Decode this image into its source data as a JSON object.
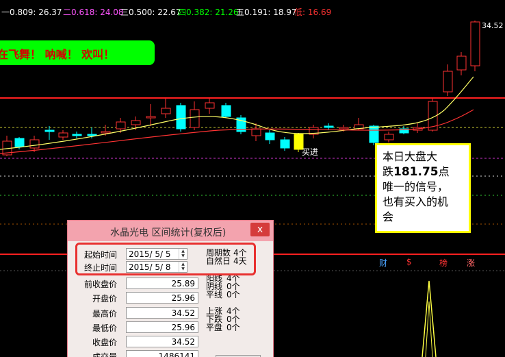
{
  "fib_levels": [
    {
      "label": "一0.809: 26.37",
      "color": "#ffffff"
    },
    {
      "label": "二0.618: 24.08",
      "color": "#ff55ff"
    },
    {
      "label": "三0.500: 22.67",
      "color": "#ffffff"
    },
    {
      "label": "四0.382: 21.26",
      "color": "#00ff00"
    },
    {
      "label": "五0.191: 18.97",
      "color": "#ffffff"
    },
    {
      "label": "低: 16.69",
      "color": "#ff3333"
    }
  ],
  "banner_text": "在飞舞！ 呐喊！ 欢叫！",
  "note": {
    "line1": "本日大盘大",
    "line2_pre": "跌",
    "line2_num": "181.75",
    "line2_post": "点",
    "line3": "唯一的信号，",
    "line4": "也有买入的机",
    "line5": "会"
  },
  "buy_label": "买进",
  "high_price_label": "34.52",
  "flags": [
    {
      "text": "财",
      "color": "#4aa3ff"
    },
    {
      "text": "$",
      "color": "#ff3333"
    },
    {
      "text": "榜",
      "color": "#ff3333"
    },
    {
      "text": "涨",
      "color": "#ff6666"
    }
  ],
  "dialog": {
    "title": "水晶光电 区间统计(复权后)",
    "close": "x",
    "start_label": "起始时间",
    "start_value": "2015/ 5/ 5",
    "end_label": "终止时间",
    "end_value": "2015/ 5/ 8",
    "period_label": "周期数",
    "period_value": "4个",
    "natural_label": "自然日",
    "natural_value": "4天",
    "fields": [
      {
        "label": "前收盘价",
        "value": "25.89"
      },
      {
        "label": "开盘价",
        "value": "25.96"
      },
      {
        "label": "最高价",
        "value": "34.52"
      },
      {
        "label": "最低价",
        "value": "25.96"
      },
      {
        "label": "收盘价",
        "value": "34.52"
      },
      {
        "label": "成交量",
        "value": "1486141"
      }
    ],
    "candles": [
      {
        "label": "阳线",
        "value": "4个"
      },
      {
        "label": "阴线",
        "value": "0个"
      },
      {
        "label": "平线",
        "value": "0个"
      }
    ],
    "moves": [
      {
        "label": "上涨",
        "value": "4个"
      },
      {
        "label": "下跌",
        "value": "0个"
      },
      {
        "label": "平盘",
        "value": "0个"
      }
    ]
  },
  "colors": {
    "up": "#ff3232",
    "down": "#00ffff",
    "ma_short": "#ffff66",
    "ma_long": "#ff3333",
    "highlight": "#e8302f"
  }
}
